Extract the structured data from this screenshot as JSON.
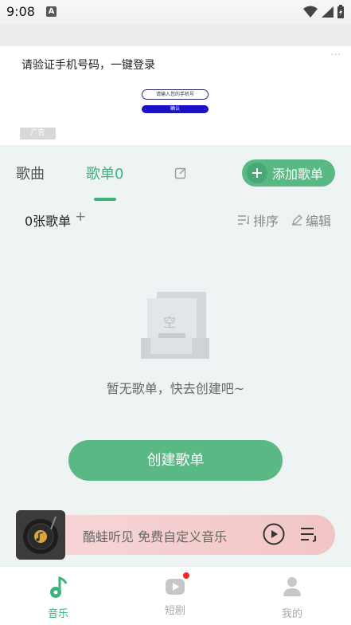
{
  "status_bar": {
    "time": "9:08",
    "notification_icon": "a-icon"
  },
  "ad": {
    "title": "请验证手机号码，一键登录",
    "more": "···",
    "field_text": "请输入您的手机号",
    "confirm_text": "确认",
    "badge": "广告"
  },
  "tabs": {
    "songs": "歌曲",
    "playlists": "歌单0"
  },
  "add_playlist_label": "添加歌单",
  "list_header": {
    "count": "0张歌单",
    "plus": "+",
    "sort": "排序",
    "edit": "编辑"
  },
  "empty": {
    "illus_char": "空",
    "text": "暂无歌单，快去创建吧~"
  },
  "create_button": "创建歌单",
  "player": {
    "title": "酷蛙听见 免费自定义音乐"
  },
  "nav": [
    {
      "label": "音乐",
      "active": true
    },
    {
      "label": "短剧",
      "badge": true
    },
    {
      "label": "我的"
    }
  ],
  "colors": {
    "accent": "#3db37c",
    "button": "#5ab885",
    "player_bg": "#f5cfcf"
  }
}
